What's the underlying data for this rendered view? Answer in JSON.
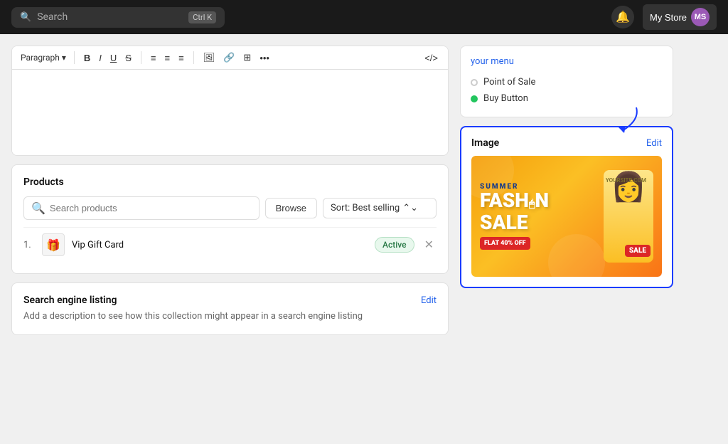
{
  "nav": {
    "search_placeholder": "Search",
    "shortcut": "Ctrl K",
    "store_name": "My Store",
    "avatar_initials": "MS",
    "bell_icon": "🔔"
  },
  "editor": {
    "toolbar": {
      "paragraph_label": "Paragraph",
      "buttons": [
        "B",
        "I",
        "U",
        "S",
        "≡",
        "≡",
        "≡",
        "⊞",
        "☰",
        "⊟"
      ]
    }
  },
  "products": {
    "title": "Products",
    "search_placeholder": "Search products",
    "browse_label": "Browse",
    "sort_label": "Sort: Best selling",
    "items": [
      {
        "num": "1.",
        "name": "Vip Gift Card",
        "status": "Active"
      }
    ]
  },
  "seo": {
    "title": "Search engine listing",
    "edit_label": "Edit",
    "description": "Add a description to see how this collection might appear in a search engine listing"
  },
  "channels": {
    "link_text": "your menu",
    "items": [
      {
        "name": "Point of Sale",
        "status": "empty"
      },
      {
        "name": "Buy Button",
        "status": "filled"
      }
    ]
  },
  "image_card": {
    "title": "Image",
    "edit_label": "Edit"
  },
  "banner": {
    "summer": "SUMMER",
    "fashion": "FASH N",
    "sale": "SALE",
    "discount": "FLAT 40% OFF",
    "site_url": "YOURSITE.COM",
    "sale_badge": "SALE"
  }
}
